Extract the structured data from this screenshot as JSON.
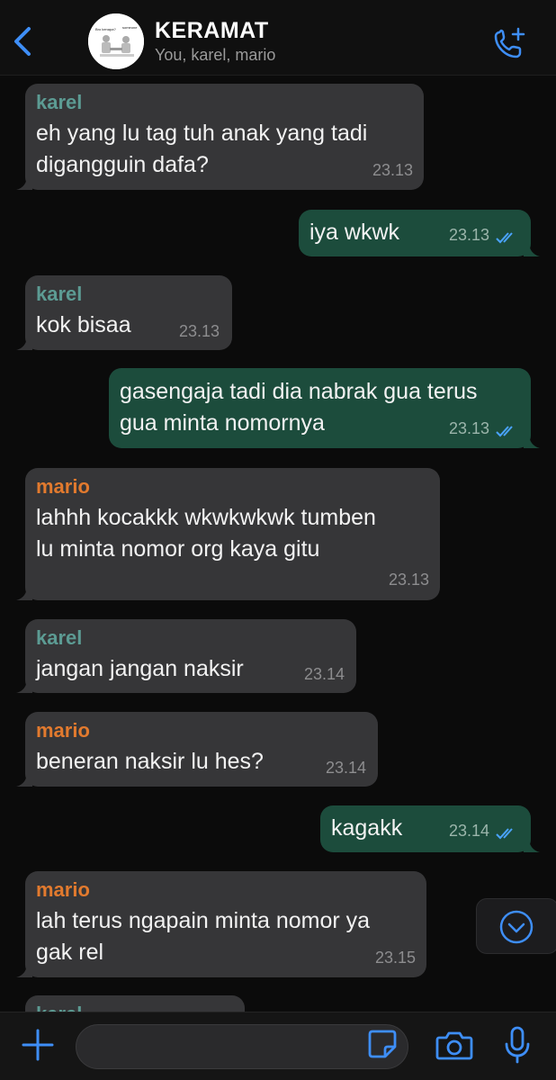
{
  "header": {
    "title": "KERAMAT",
    "subtitle": "You, karel, mario",
    "avatar_text_left": "Bro kenapa?",
    "avatar_text_right": "someone"
  },
  "messages": [
    {
      "direction": "in",
      "sender": "karel",
      "text": "eh yang lu tag tuh anak yang tadi\ndigangguin dafa?",
      "time": "23.13"
    },
    {
      "direction": "out",
      "text": "iya wkwk",
      "time": "23.13",
      "status": "read"
    },
    {
      "direction": "in",
      "sender": "karel",
      "text": "kok bisaa",
      "time": "23.13"
    },
    {
      "direction": "out",
      "text": "gasengaja tadi dia nabrak gua terus\ngua minta nomornya",
      "time": "23.13",
      "status": "read"
    },
    {
      "direction": "in",
      "sender": "mario",
      "text": "lahhh kocakkk wkwkwkwk tumben\nlu minta nomor org kaya gitu",
      "time": "23.13"
    },
    {
      "direction": "in",
      "sender": "karel",
      "text": "jangan jangan naksir",
      "time": "23.14"
    },
    {
      "direction": "in",
      "sender": "mario",
      "text": "beneran naksir lu hes?",
      "time": "23.14"
    },
    {
      "direction": "out",
      "text": "kagakk",
      "time": "23.14",
      "status": "read"
    },
    {
      "direction": "in",
      "sender": "mario",
      "text": "lah terus ngapain minta nomor ya\ngak rel",
      "time": "23.15"
    },
    {
      "direction": "in",
      "sender": "karel",
      "text": "",
      "time": ""
    }
  ],
  "colors": {
    "background": "#0b0b0b",
    "incoming_bubble": "#363638",
    "outgoing_bubble": "#1c4c3c",
    "accent": "#3e8ef7",
    "karel": "#5c9b93",
    "mario": "#e27a2e"
  },
  "icons": [
    "back-chevron-icon",
    "add-call-icon",
    "scroll-down-icon",
    "plus-icon",
    "sticker-icon",
    "camera-icon",
    "microphone-icon",
    "double-check-icon"
  ]
}
